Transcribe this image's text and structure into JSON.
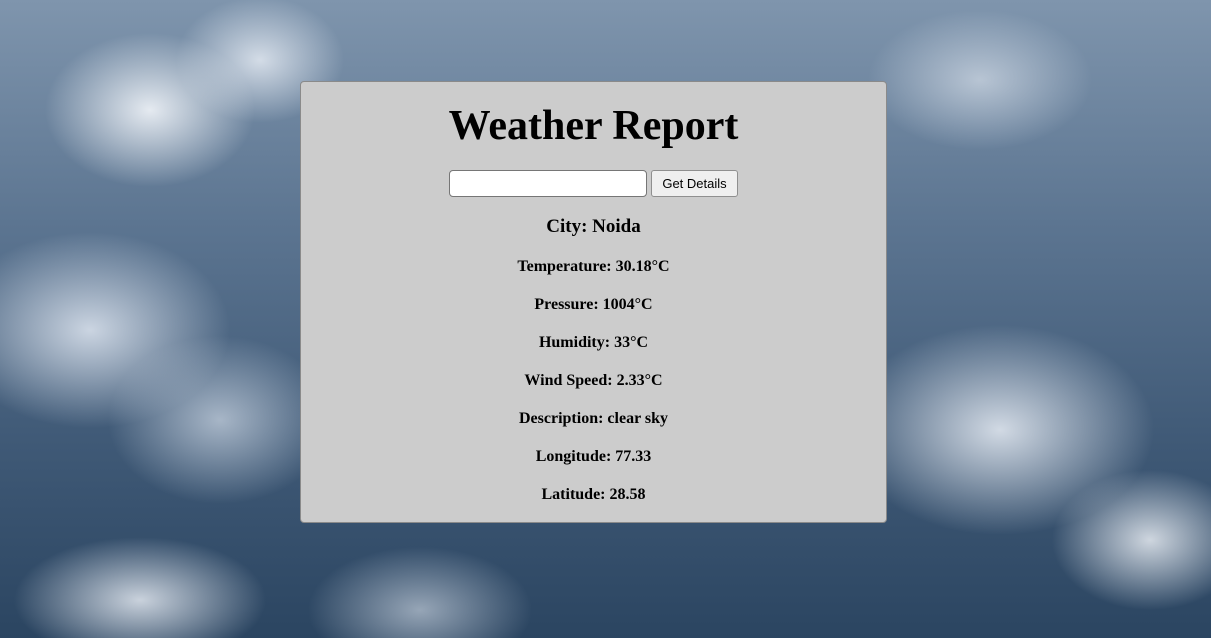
{
  "page": {
    "title": "Weather Report"
  },
  "search": {
    "value": "",
    "placeholder": "",
    "button_label": "Get Details"
  },
  "result": {
    "city": "City: Noida",
    "temperature": "Temperature: 30.18°C",
    "pressure": "Pressure: 1004°C",
    "humidity": "Humidity: 33°C",
    "wind_speed": "Wind Speed: 2.33°C",
    "description": "Description: clear sky",
    "longitude": "Longitude: 77.33",
    "latitude": "Latitude: 28.58"
  },
  "colors": {
    "card_background": "#cccccc",
    "background_sky": "#5c7591"
  }
}
